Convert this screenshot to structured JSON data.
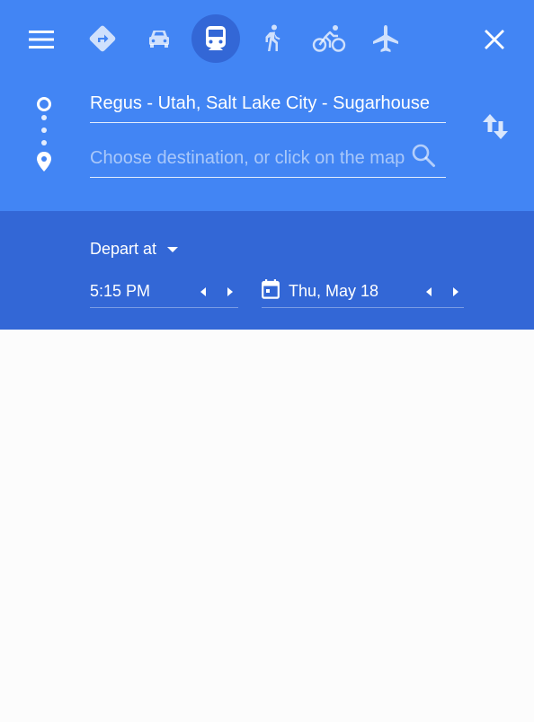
{
  "header": {
    "menu_icon": "menu-icon",
    "close_icon": "close-icon",
    "travel_modes": [
      {
        "name": "best-route",
        "icon": "directions-icon"
      },
      {
        "name": "driving",
        "icon": "car-icon"
      },
      {
        "name": "transit",
        "icon": "train-icon",
        "selected": true
      },
      {
        "name": "walking",
        "icon": "walk-icon"
      },
      {
        "name": "cycling",
        "icon": "bike-icon"
      },
      {
        "name": "flights",
        "icon": "plane-icon"
      }
    ]
  },
  "route": {
    "origin_value": "Regus - Utah, Salt Lake City - Sugarhouse",
    "destination_value": "",
    "destination_placeholder": "Choose destination, or click on the map...",
    "search_icon": "search-icon",
    "swap_icon": "swap-icon"
  },
  "schedule": {
    "depart_label": "Depart at",
    "time": "5:15 PM",
    "date": "Thu, May 18",
    "calendar_icon": "calendar-icon"
  },
  "colors": {
    "header_blue": "#4285f4",
    "subheader_blue": "#3367d6",
    "body_background": "#fcfcfc"
  }
}
